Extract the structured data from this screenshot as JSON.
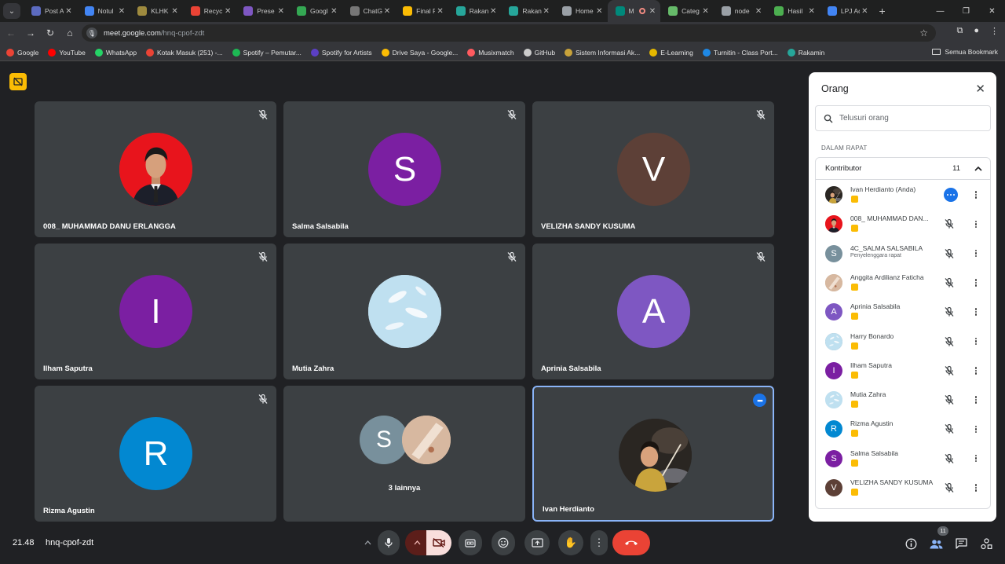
{
  "browser": {
    "tabs": [
      {
        "label": "Post A",
        "fav": "#5c6bc0"
      },
      {
        "label": "Notul",
        "fav": "#4285f4"
      },
      {
        "label": "KLHK",
        "fav": "#9e8a3e"
      },
      {
        "label": "Recyc",
        "fav": "#ea4335"
      },
      {
        "label": "Prese",
        "fav": "#7e57c2"
      },
      {
        "label": "Googl",
        "fav": "#34a853"
      },
      {
        "label": "ChatG",
        "fav": "#777777"
      },
      {
        "label": "Final F",
        "fav": "#fbbc04"
      },
      {
        "label": "Rakan",
        "fav": "#26a69a"
      },
      {
        "label": "Rakan",
        "fav": "#26a69a"
      },
      {
        "label": "Home",
        "fav": "#9aa0a6"
      },
      {
        "label": "M",
        "fav": "#00897b",
        "active": true
      },
      {
        "label": "Categ",
        "fav": "#66bb6a"
      },
      {
        "label": "node",
        "fav": "#9aa0a6"
      },
      {
        "label": "Hasil",
        "fav": "#4caf50"
      },
      {
        "label": "LPJ Ac",
        "fav": "#4285f4"
      }
    ],
    "url_host": "meet.google.com",
    "url_path": "/hnq-cpof-zdt",
    "bookmarks": [
      {
        "label": "Google",
        "color": "#ea4335"
      },
      {
        "label": "YouTube",
        "color": "#ff0000"
      },
      {
        "label": "WhatsApp",
        "color": "#25d366"
      },
      {
        "label": "Kotak Masuk (251) -...",
        "color": "#ea4335"
      },
      {
        "label": "Spotify – Pemutar...",
        "color": "#1db954"
      },
      {
        "label": "Spotify for Artists",
        "color": "#5b3fc4"
      },
      {
        "label": "Drive Saya - Google...",
        "color": "#fbbc04"
      },
      {
        "label": "Musixmatch",
        "color": "#ff5a5f"
      },
      {
        "label": "GitHub",
        "color": "#cccccc"
      },
      {
        "label": "Sistem Informasi Ak...",
        "color": "#c8a23a"
      },
      {
        "label": "E-Learning",
        "color": "#e5b800"
      },
      {
        "label": "Turnitin - Class Port...",
        "color": "#1e88e5"
      },
      {
        "label": "Rakamin",
        "color": "#26a69a"
      }
    ],
    "all_bookmarks": "Semua Bookmark"
  },
  "tiles": [
    {
      "name": "008_ MUHAMMAD DANU ERLANGGA",
      "initial": "",
      "bg": "#e53935",
      "photo": "person-red"
    },
    {
      "name": "Salma Salsabila",
      "initial": "S",
      "bg": "#7b1fa2"
    },
    {
      "name": "VELIZHA SANDY KUSUMA",
      "initial": "V",
      "bg": "#5d4037"
    },
    {
      "name": "Ilham Saputra",
      "initial": "I",
      "bg": "#7b1fa2"
    },
    {
      "name": "Mutia Zahra",
      "initial": "",
      "bg": "#bcdcee",
      "photo": "feathers"
    },
    {
      "name": "Aprinia Salsabila",
      "initial": "A",
      "bg": "#7e57c2"
    },
    {
      "name": "Rizma Agustin",
      "initial": "R",
      "bg": "#0288d1"
    },
    {
      "name": "3 lainnya",
      "initial": "S",
      "bg": "#78909c"
    },
    {
      "name": "Ivan Herdianto",
      "initial": "",
      "bg": "#2b2b2b",
      "photo": "kid"
    }
  ],
  "panel": {
    "title": "Orang",
    "search_placeholder": "Telusuri orang",
    "section": "DALAM RAPAT",
    "group_label": "Kontributor",
    "group_count": "11",
    "people": [
      {
        "name": "Ivan Herdianto (Anda)",
        "initial": "",
        "bg": "#555555",
        "badge": true,
        "active": true
      },
      {
        "name": "008_ MUHAMMAD DAN...",
        "initial": "",
        "bg": "#e53935",
        "badge": true
      },
      {
        "name": "4C_SALMA SALSABILA",
        "initial": "S",
        "bg": "#78909c",
        "sub": "Penyelenggara rapat"
      },
      {
        "name": "Anggita Ardilianz Faticha",
        "initial": "",
        "bg": "#b39b7a",
        "badge": true
      },
      {
        "name": "Aprinia Salsabila",
        "initial": "A",
        "bg": "#7e57c2",
        "badge": true
      },
      {
        "name": "Harry Bonardo",
        "initial": "",
        "bg": "#7a8fa0",
        "badge": true
      },
      {
        "name": "Ilham Saputra",
        "initial": "I",
        "bg": "#7b1fa2",
        "badge": true
      },
      {
        "name": "Mutia Zahra",
        "initial": "",
        "bg": "#bcdcee",
        "badge": true
      },
      {
        "name": "Rizma Agustin",
        "initial": "R",
        "bg": "#0288d1",
        "badge": true
      },
      {
        "name": "Salma Salsabila",
        "initial": "S",
        "bg": "#7b1fa2",
        "badge": true
      },
      {
        "name": "VELIZHA SANDY KUSUMA",
        "initial": "V",
        "bg": "#5d4037",
        "badge": true
      }
    ]
  },
  "bottom": {
    "time": "21.48",
    "meeting_code": "hnq-cpof-zdt",
    "participant_count": "11"
  },
  "colors": {
    "end_call": "#ea4335",
    "cam_off": "#f9dedc",
    "accent": "#1a73e8"
  }
}
